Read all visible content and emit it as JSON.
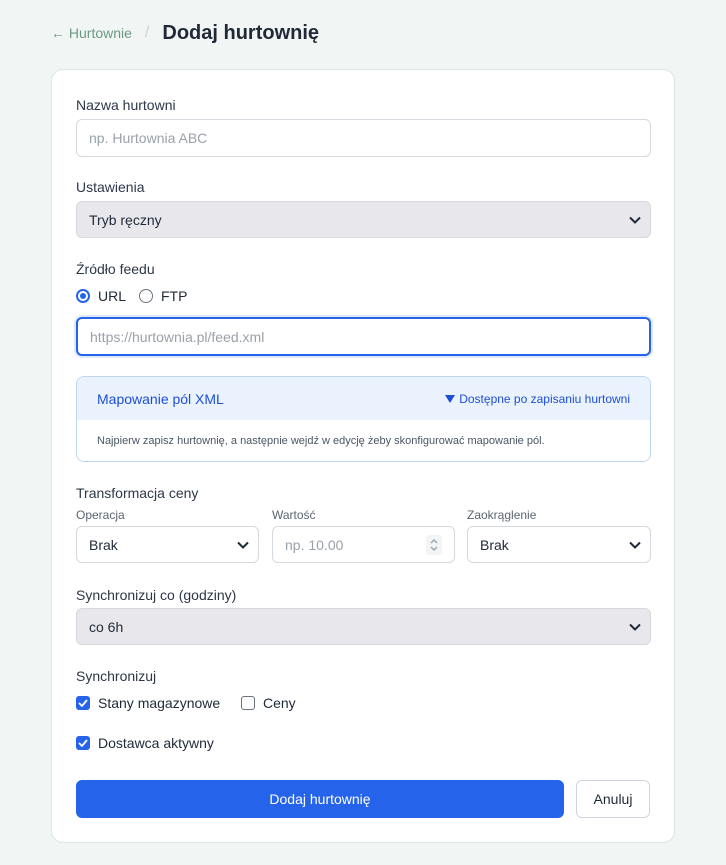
{
  "header": {
    "back_label": "← Hurtownie",
    "separator": "/",
    "title": "Dodaj hurtownię"
  },
  "form": {
    "name": {
      "label": "Nazwa hurtowni",
      "placeholder": "np. Hurtownia ABC",
      "value": ""
    },
    "settings": {
      "label": "Ustawienia",
      "selected": "Tryb ręczny"
    },
    "feed_source": {
      "label": "Źródło feedu",
      "options": [
        {
          "label": "URL",
          "checked": true
        },
        {
          "label": "FTP",
          "checked": false
        }
      ],
      "url_placeholder": "https://hurtownia.pl/feed.xml"
    },
    "mapping": {
      "title": "Mapowanie pól XML",
      "toggle_label": "Dostępne po zapisaniu hurtowni",
      "toggle_icon": "triangle-down-icon",
      "description": "Najpierw zapisz hurtownię, a następnie wejdź w edycję żeby skonfigurować mapowanie pól."
    },
    "price_transform": {
      "label": "Transformacja ceny",
      "operation": {
        "label": "Operacja",
        "selected": "Brak"
      },
      "value": {
        "label": "Wartość",
        "placeholder": "np. 10.00"
      },
      "rounding": {
        "label": "Zaokrąglenie",
        "selected": "Brak"
      }
    },
    "sync_interval": {
      "label": "Synchronizuj co (godziny)",
      "selected": "co 6h"
    },
    "sync": {
      "label": "Synchronizuj",
      "options": [
        {
          "label": "Stany magazynowe",
          "checked": true
        },
        {
          "label": "Ceny",
          "checked": false
        }
      ]
    },
    "active": {
      "label": "Dostawca aktywny",
      "checked": true
    },
    "submit_label": "Dodaj hurtownię",
    "cancel_label": "Anuluj"
  },
  "colors": {
    "accent": "#2563eb",
    "background": "#f1f5f3",
    "link": "#6b9a83"
  }
}
